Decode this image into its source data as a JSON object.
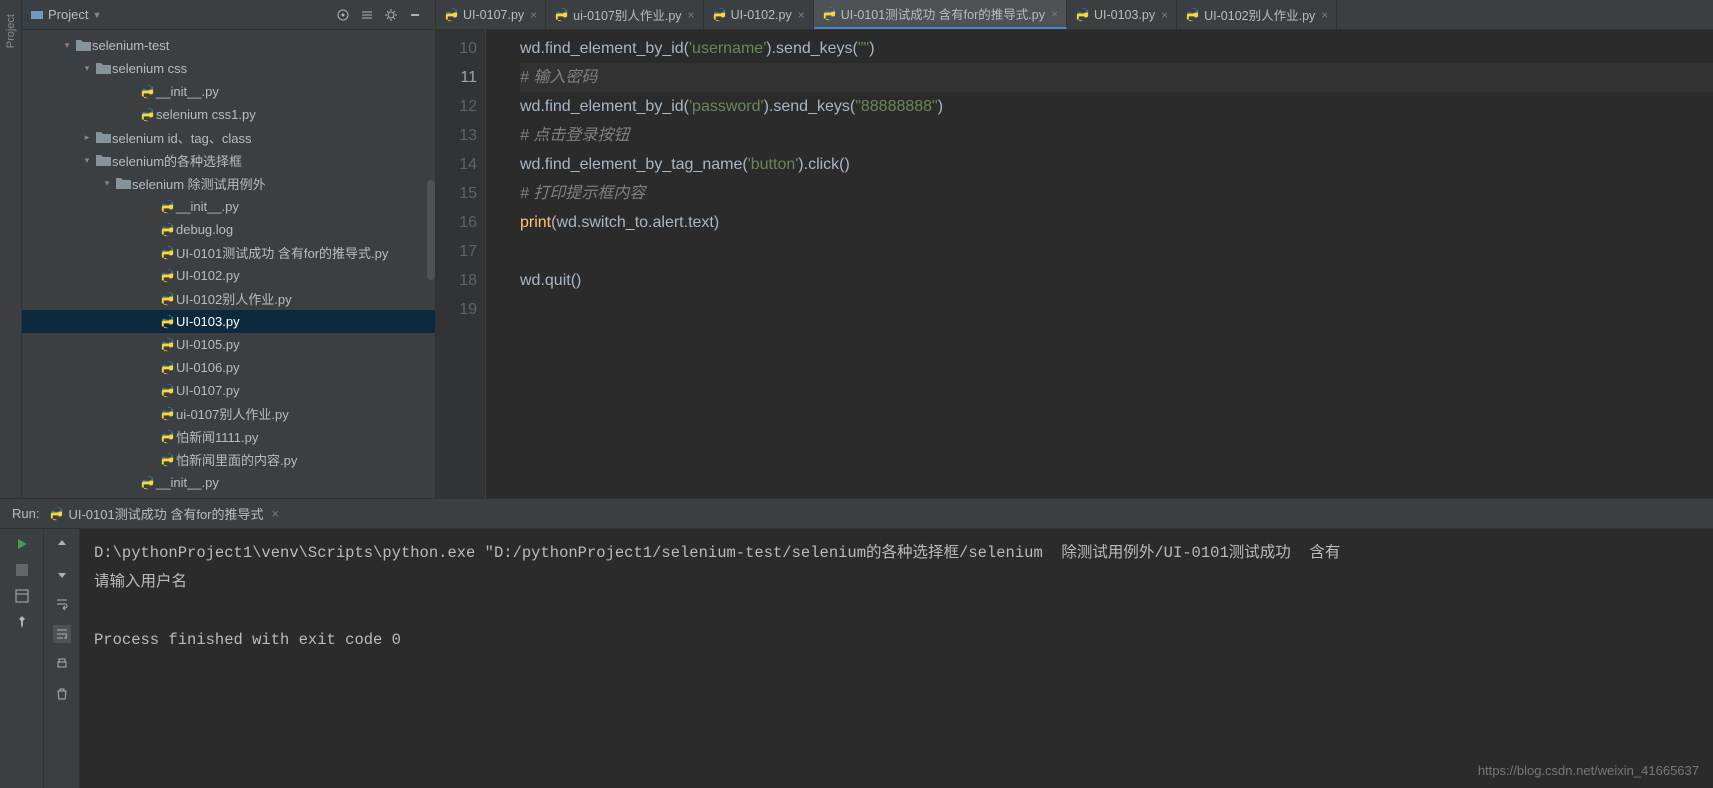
{
  "sidebar": {
    "title": "Project",
    "tree": [
      {
        "indent": 38,
        "arrow": "down",
        "icon": "folder",
        "label": "selenium-test"
      },
      {
        "indent": 58,
        "arrow": "down",
        "icon": "folder",
        "label": "selenium css"
      },
      {
        "indent": 102,
        "arrow": "",
        "icon": "py",
        "label": "__init__.py"
      },
      {
        "indent": 102,
        "arrow": "",
        "icon": "py",
        "label": "selenium css1.py"
      },
      {
        "indent": 58,
        "arrow": "right",
        "icon": "folder",
        "label": "selenium id、tag、class"
      },
      {
        "indent": 58,
        "arrow": "down",
        "icon": "folder",
        "label": "selenium的各种选择框"
      },
      {
        "indent": 78,
        "arrow": "down",
        "icon": "folder",
        "label": "selenium  除测试用例外"
      },
      {
        "indent": 122,
        "arrow": "",
        "icon": "py",
        "label": "__init__.py"
      },
      {
        "indent": 122,
        "arrow": "",
        "icon": "py",
        "label": "debug.log"
      },
      {
        "indent": 122,
        "arrow": "",
        "icon": "py",
        "label": "UI-0101测试成功  含有for的推导式.py"
      },
      {
        "indent": 122,
        "arrow": "",
        "icon": "py",
        "label": "UI-0102.py"
      },
      {
        "indent": 122,
        "arrow": "",
        "icon": "py",
        "label": "UI-0102别人作业.py"
      },
      {
        "indent": 122,
        "arrow": "",
        "icon": "py",
        "label": "UI-0103.py",
        "selected": true
      },
      {
        "indent": 122,
        "arrow": "",
        "icon": "py",
        "label": "UI-0105.py"
      },
      {
        "indent": 122,
        "arrow": "",
        "icon": "py",
        "label": "UI-0106.py"
      },
      {
        "indent": 122,
        "arrow": "",
        "icon": "py",
        "label": "UI-0107.py"
      },
      {
        "indent": 122,
        "arrow": "",
        "icon": "py",
        "label": "ui-0107别人作业.py"
      },
      {
        "indent": 122,
        "arrow": "",
        "icon": "py",
        "label": "怕新闻1111.py"
      },
      {
        "indent": 122,
        "arrow": "",
        "icon": "py",
        "label": "怕新闻里面的内容.py"
      },
      {
        "indent": 102,
        "arrow": "",
        "icon": "py",
        "label": "__init__.py"
      }
    ]
  },
  "tabs": [
    {
      "label": "UI-0107.py"
    },
    {
      "label": "ui-0107别人作业.py"
    },
    {
      "label": "UI-0102.py"
    },
    {
      "label": "UI-0101测试成功  含有for的推导式.py",
      "active": true
    },
    {
      "label": "UI-0103.py"
    },
    {
      "label": "UI-0102别人作业.py"
    }
  ],
  "code": {
    "start": 10,
    "cursor_line": 11,
    "lines": [
      [
        {
          "t": "wd.find_element_by_id(",
          "c": "def"
        },
        {
          "t": "'username'",
          "c": "str"
        },
        {
          "t": ").send_keys(",
          "c": "def"
        },
        {
          "t": "\"\"",
          "c": "str"
        },
        {
          "t": ")",
          "c": "def"
        }
      ],
      [
        {
          "t": "# 输入密码",
          "c": "cmt"
        }
      ],
      [
        {
          "t": "wd.find_element_by_id(",
          "c": "def"
        },
        {
          "t": "'password'",
          "c": "str"
        },
        {
          "t": ").send_keys(",
          "c": "def"
        },
        {
          "t": "\"88888888\"",
          "c": "str"
        },
        {
          "t": ")",
          "c": "def"
        }
      ],
      [
        {
          "t": "# 点击登录按钮",
          "c": "cmt"
        }
      ],
      [
        {
          "t": "wd.find_element_by_tag_name(",
          "c": "def"
        },
        {
          "t": "'button'",
          "c": "str"
        },
        {
          "t": ").click()",
          "c": "def"
        }
      ],
      [
        {
          "t": "# 打印提示框内容",
          "c": "cmt"
        }
      ],
      [
        {
          "t": "print",
          "c": "fn"
        },
        {
          "t": "(wd.switch_to.alert.text)",
          "c": "def"
        }
      ],
      [],
      [
        {
          "t": "wd.quit()",
          "c": "def"
        }
      ],
      []
    ]
  },
  "run": {
    "label": "Run:",
    "tab": "UI-0101测试成功  含有for的推导式",
    "output": [
      "D:\\pythonProject1\\venv\\Scripts\\python.exe \"D:/pythonProject1/selenium-test/selenium的各种选择框/selenium  除测试用例外/UI-0101测试成功  含有",
      "请输入用户名",
      "",
      "Process finished with exit code 0"
    ]
  },
  "watermark": "https://blog.csdn.net/weixin_41665637"
}
